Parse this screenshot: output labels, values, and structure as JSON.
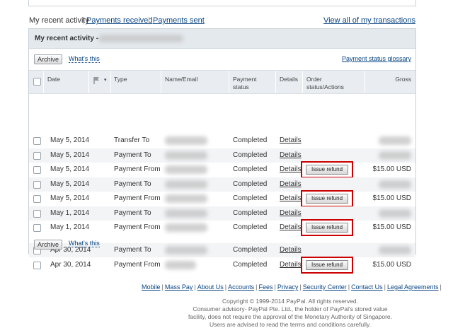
{
  "tabs": {
    "recent": "My recent activity",
    "received": "Payments received",
    "sent": "Payments sent",
    "view_all": "View all of my transactions"
  },
  "panel": {
    "title": "My recent activity -",
    "archive_label": "Archive",
    "whats_this": "What's this",
    "glossary": "Payment status glossary"
  },
  "columns": {
    "date": "Date",
    "type": "Type",
    "name_email": "Name/Email",
    "payment_status_1": "Payment",
    "payment_status_2": "status",
    "details": "Details",
    "order_1": "Order",
    "order_2": "status/Actions",
    "gross": "Gross"
  },
  "rows": [
    {
      "date": "May 5, 2014",
      "type": "Transfer To",
      "status": "Completed",
      "details": "Details",
      "action": "",
      "gross": ""
    },
    {
      "date": "May 5, 2014",
      "type": "Payment To",
      "status": "Completed",
      "details": "Details",
      "action": "",
      "gross": ""
    },
    {
      "date": "May 5, 2014",
      "type": "Payment From",
      "status": "Completed",
      "details": "Details",
      "action": "Issue refund",
      "gross": "$15.00 USD"
    },
    {
      "date": "May 5, 2014",
      "type": "Payment To",
      "status": "Completed",
      "details": "Details",
      "action": "",
      "gross": ""
    },
    {
      "date": "May 5, 2014",
      "type": "Payment From",
      "status": "Completed",
      "details": "Details",
      "action": "Issue refund",
      "gross": "$15.00 USD"
    },
    {
      "date": "May 1, 2014",
      "type": "Payment To",
      "status": "Completed",
      "details": "Details",
      "action": "",
      "gross": ""
    },
    {
      "date": "May 1, 2014",
      "type": "Payment From",
      "status": "Completed",
      "details": "Details",
      "action": "Issue refund",
      "gross": "$15.00 USD"
    },
    {
      "date": "Apr 30, 2014",
      "type": "Payment To",
      "status": "Completed",
      "details": "Details",
      "action": "",
      "gross": ""
    },
    {
      "date": "Apr 30, 2014",
      "type": "Payment From",
      "status": "Completed",
      "details": "Details",
      "action": "Issue refund",
      "gross": "$15.00 USD"
    }
  ],
  "footer": {
    "links": [
      "Mobile",
      "Mass Pay",
      "About Us",
      "Accounts",
      "Fees",
      "Privacy",
      "Security Center",
      "Contact Us",
      "Legal Agreements"
    ],
    "copyright": "Copyright © 1999-2014 PayPal. All rights reserved.",
    "advisory_1": "Consumer advisory- PayPal Pte. Ltd., the holder of PayPal's stored value",
    "advisory_2": "facility, does not require the approval of the Monetary Authority of Singapore.",
    "advisory_3": "Users are advised to read the terms and conditions carefully."
  },
  "colors": {
    "link": "#084482",
    "highlight": "#cc0000",
    "header_bg": "#e4e9ee"
  }
}
